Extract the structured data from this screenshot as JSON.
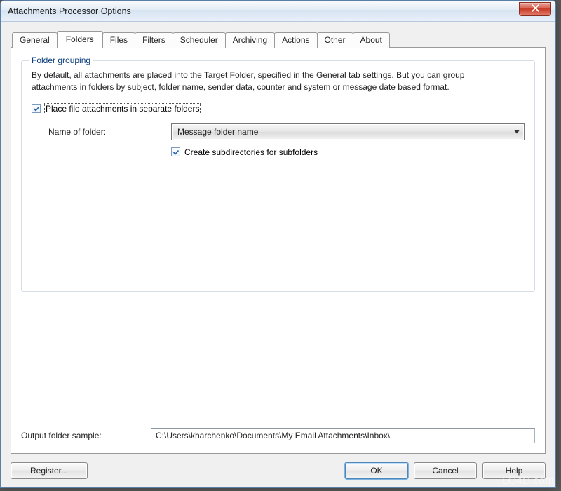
{
  "window": {
    "title": "Attachments Processor Options"
  },
  "tabs": {
    "items": [
      {
        "label": "General"
      },
      {
        "label": "Folders"
      },
      {
        "label": "Files"
      },
      {
        "label": "Filters"
      },
      {
        "label": "Scheduler"
      },
      {
        "label": "Archiving"
      },
      {
        "label": "Actions"
      },
      {
        "label": "Other"
      },
      {
        "label": "About"
      }
    ],
    "active_index": 1
  },
  "group": {
    "title": "Folder grouping",
    "description": "By default, all attachments are placed into the Target Folder, specified in the General tab settings. But you can group attachments in folders by subject, folder name, sender data, counter and system or message date based format.",
    "place_checkbox_label": "Place file attachments in separate folders",
    "place_checkbox_checked": true,
    "name_of_folder_label": "Name of folder:",
    "name_of_folder_value": "Message folder name",
    "create_subdirs_label": "Create subdirectories for subfolders",
    "create_subdirs_checked": true
  },
  "output": {
    "label": "Output folder sample:",
    "value": "C:\\Users\\kharchenko\\Documents\\My Email Attachments\\Inbox\\"
  },
  "buttons": {
    "register": "Register...",
    "ok": "OK",
    "cancel": "Cancel",
    "help": "Help"
  },
  "watermark": "LO4D.com",
  "icons": {
    "close": "close-icon",
    "check": "checkmark-icon",
    "dropdown": "chevron-down-icon"
  }
}
